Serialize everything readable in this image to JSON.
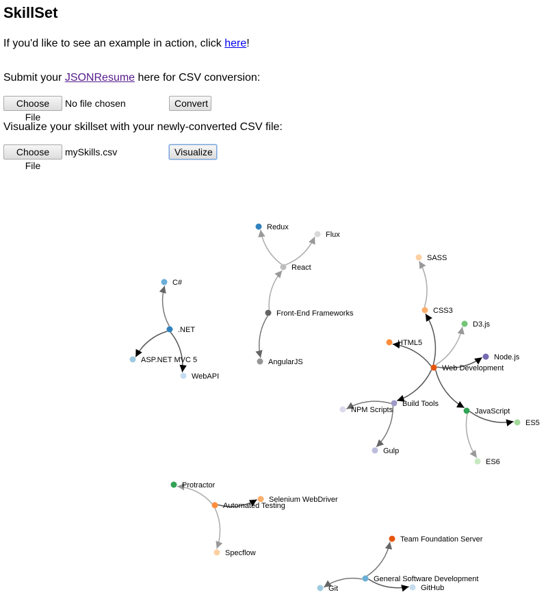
{
  "page": {
    "title": "SkillSet",
    "example_prefix": "If you'd like to see an example in action, click ",
    "example_link": "here",
    "example_suffix": "!",
    "submit_prefix": "Submit your ",
    "submit_link": "JSONResume",
    "submit_suffix": " here for CSV conversion:",
    "visualize_text": "Visualize your skillset with your newly-converted CSV file:"
  },
  "form1": {
    "choose_label": "Choose File",
    "file_status": "No file chosen",
    "convert_label": "Convert"
  },
  "form2": {
    "choose_label": "Choose File",
    "file_status": "mySkills.csv",
    "visualize_label": "Visualize"
  },
  "graph": {
    "nodes": [
      {
        "id": "redux",
        "label": "Redux",
        "color": "#3182bd"
      },
      {
        "id": "flux",
        "label": "Flux",
        "color": "#d9d9d9"
      },
      {
        "id": "react",
        "label": "React",
        "color": "#bdbdbd"
      },
      {
        "id": "fef",
        "label": "Front-End Frameworks",
        "color": "#636363"
      },
      {
        "id": "angular",
        "label": "AngularJS",
        "color": "#969696"
      },
      {
        "id": "csharp",
        "label": "C#",
        "color": "#6baed6"
      },
      {
        "id": "dotnet",
        "label": ".NET",
        "color": "#3182bd"
      },
      {
        "id": "aspnet",
        "label": "ASP.NET MVC 5",
        "color": "#9ecae1"
      },
      {
        "id": "webapi",
        "label": "WebAPI",
        "color": "#c6dbef"
      },
      {
        "id": "sass",
        "label": "SASS",
        "color": "#fdd0a2"
      },
      {
        "id": "css3",
        "label": "CSS3",
        "color": "#fdae6b"
      },
      {
        "id": "d3",
        "label": "D3.js",
        "color": "#74c476"
      },
      {
        "id": "html5",
        "label": "HTML5",
        "color": "#fd8d3c"
      },
      {
        "id": "node",
        "label": "Node.js",
        "color": "#756bb1"
      },
      {
        "id": "webdev",
        "label": "Web Development",
        "color": "#e6550d"
      },
      {
        "id": "build",
        "label": "Build Tools",
        "color": "#9e9ac8"
      },
      {
        "id": "npm",
        "label": "NPM Scripts",
        "color": "#dadaeb"
      },
      {
        "id": "js",
        "label": "JavaScript",
        "color": "#31a354"
      },
      {
        "id": "es5",
        "label": "ES5",
        "color": "#a1d99b"
      },
      {
        "id": "gulp",
        "label": "Gulp",
        "color": "#bcbddc"
      },
      {
        "id": "es6",
        "label": "ES6",
        "color": "#c7e9c0"
      },
      {
        "id": "protractor",
        "label": "Protractor",
        "color": "#31a354"
      },
      {
        "id": "selenium",
        "label": "Selenium WebDriver",
        "color": "#fdae6b"
      },
      {
        "id": "autotest",
        "label": "Automated Testing",
        "color": "#fd8d3c"
      },
      {
        "id": "specflow",
        "label": "Specflow",
        "color": "#fdd0a2"
      },
      {
        "id": "tfs",
        "label": "Team Foundation Server",
        "color": "#e6550d"
      },
      {
        "id": "gsd",
        "label": "General Software Development",
        "color": "#6baed6"
      },
      {
        "id": "git",
        "label": "Git",
        "color": "#9ecae1"
      },
      {
        "id": "github",
        "label": "GitHub",
        "color": "#c6dbef"
      }
    ],
    "links": [
      {
        "source": "react",
        "target": "redux"
      },
      {
        "source": "react",
        "target": "flux"
      },
      {
        "source": "fef",
        "target": "react"
      },
      {
        "source": "fef",
        "target": "angular"
      },
      {
        "source": "dotnet",
        "target": "csharp"
      },
      {
        "source": "dotnet",
        "target": "aspnet"
      },
      {
        "source": "dotnet",
        "target": "webapi"
      },
      {
        "source": "css3",
        "target": "sass"
      },
      {
        "source": "webdev",
        "target": "css3"
      },
      {
        "source": "webdev",
        "target": "d3"
      },
      {
        "source": "webdev",
        "target": "html5"
      },
      {
        "source": "webdev",
        "target": "node"
      },
      {
        "source": "webdev",
        "target": "build"
      },
      {
        "source": "webdev",
        "target": "js"
      },
      {
        "source": "build",
        "target": "npm"
      },
      {
        "source": "build",
        "target": "gulp"
      },
      {
        "source": "js",
        "target": "es5"
      },
      {
        "source": "js",
        "target": "es6"
      },
      {
        "source": "autotest",
        "target": "protractor"
      },
      {
        "source": "autotest",
        "target": "selenium"
      },
      {
        "source": "autotest",
        "target": "specflow"
      },
      {
        "source": "gsd",
        "target": "tfs"
      },
      {
        "source": "gsd",
        "target": "git"
      },
      {
        "source": "gsd",
        "target": "github"
      }
    ]
  }
}
